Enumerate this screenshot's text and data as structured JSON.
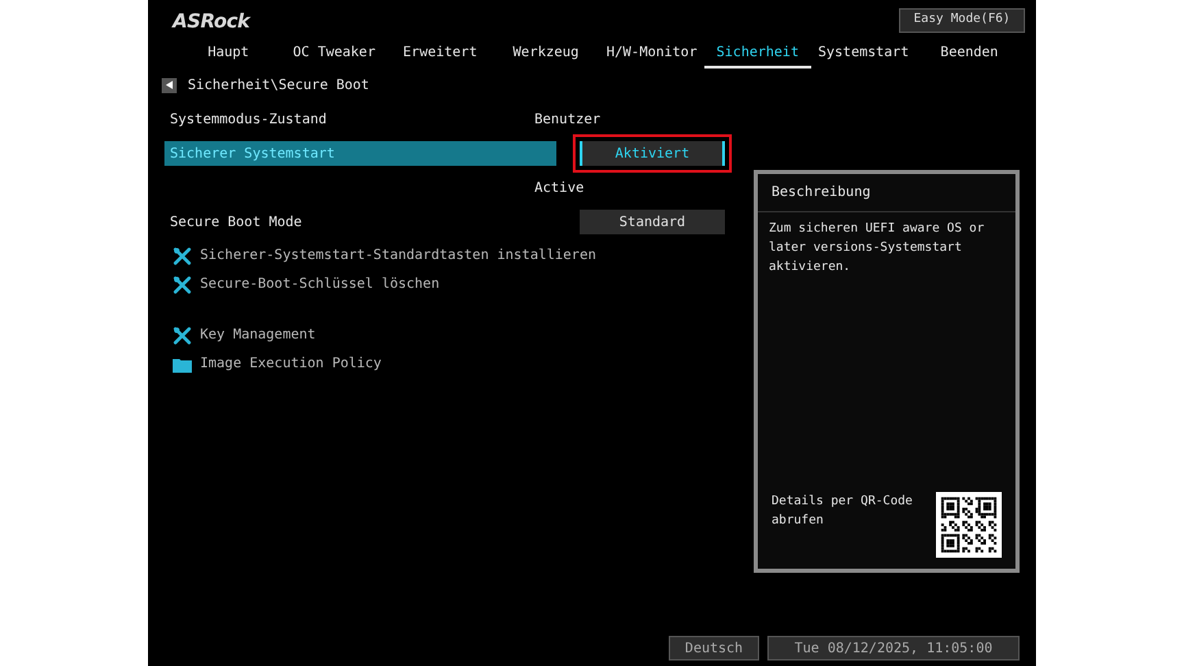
{
  "header": {
    "logo": "ASRock",
    "easy_mode_button": "Easy Mode(F6)"
  },
  "tabs": [
    {
      "label": "Haupt",
      "selected": false
    },
    {
      "label": "OC Tweaker",
      "selected": false
    },
    {
      "label": "Erweitert",
      "selected": false
    },
    {
      "label": "Werkzeug",
      "selected": false
    },
    {
      "label": "H/W-Monitor",
      "selected": false
    },
    {
      "label": "Sicherheit",
      "selected": true
    },
    {
      "label": "Systemstart",
      "selected": false
    },
    {
      "label": "Beenden",
      "selected": false
    }
  ],
  "breadcrumb": "Sicherheit\\Secure Boot",
  "settings": [
    {
      "kind": "info",
      "label": "Systemmodus-Zustand",
      "value": "Benutzer"
    },
    {
      "kind": "option",
      "label": "Sicherer Systemstart",
      "value": "Aktiviert",
      "selected": true,
      "outlined": true
    },
    {
      "kind": "status",
      "value": "Active"
    },
    {
      "kind": "option",
      "label": "Secure Boot Mode",
      "value": "Standard",
      "selected": false,
      "outlined": false
    },
    {
      "kind": "action",
      "label": "Sicherer-Systemstart-Standardtasten installieren"
    },
    {
      "kind": "action",
      "label": "Secure-Boot-Schlüssel löschen"
    },
    {
      "kind": "spacer"
    },
    {
      "kind": "action",
      "label": "Key Management"
    },
    {
      "kind": "submenu",
      "label": "Image Execution Policy"
    }
  ],
  "description": {
    "title": "Beschreibung",
    "text": "Zum sicheren UEFI aware OS or later versions-Systemstart aktivieren.",
    "qr_caption": "Details per QR-Code abrufen"
  },
  "status_bar": {
    "language": "Deutsch",
    "datetime": "Tue 08/12/2025, 11:05:00"
  }
}
